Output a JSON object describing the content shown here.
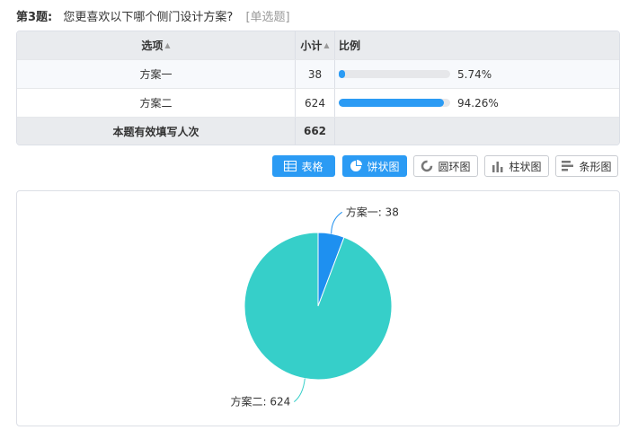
{
  "question": {
    "number": "第3题:",
    "text": "您更喜欢以下哪个侧门设计方案?",
    "type": "[单选题]"
  },
  "table": {
    "headers": {
      "option": "选项",
      "count": "小计",
      "ratio": "比例"
    },
    "rows": [
      {
        "option": "方案一",
        "count": "38",
        "percent": "5.74%",
        "fraction": 0.0574
      },
      {
        "option": "方案二",
        "count": "624",
        "percent": "94.26%",
        "fraction": 0.9426
      }
    ],
    "footer": {
      "label": "本题有效填写人次",
      "count": "662"
    }
  },
  "toolbar": {
    "buttons": [
      {
        "label": "表格",
        "icon": "table-icon",
        "active": true
      },
      {
        "label": "饼状图",
        "icon": "pie-chart-icon",
        "active": true
      },
      {
        "label": "圆环图",
        "icon": "donut-chart-icon",
        "active": false
      },
      {
        "label": "柱状图",
        "icon": "bar-chart-icon",
        "active": false
      },
      {
        "label": "条形图",
        "icon": "horizontal-bar-icon",
        "active": false
      }
    ]
  },
  "colors": {
    "accent": "#2b9bf4",
    "slice1": "#1e90f0",
    "slice2": "#36cfc9"
  },
  "chart_data": {
    "type": "pie",
    "categories": [
      "方案一",
      "方案二"
    ],
    "values": [
      38,
      624
    ],
    "labels": [
      "方案一: 38",
      "方案二: 624"
    ]
  }
}
